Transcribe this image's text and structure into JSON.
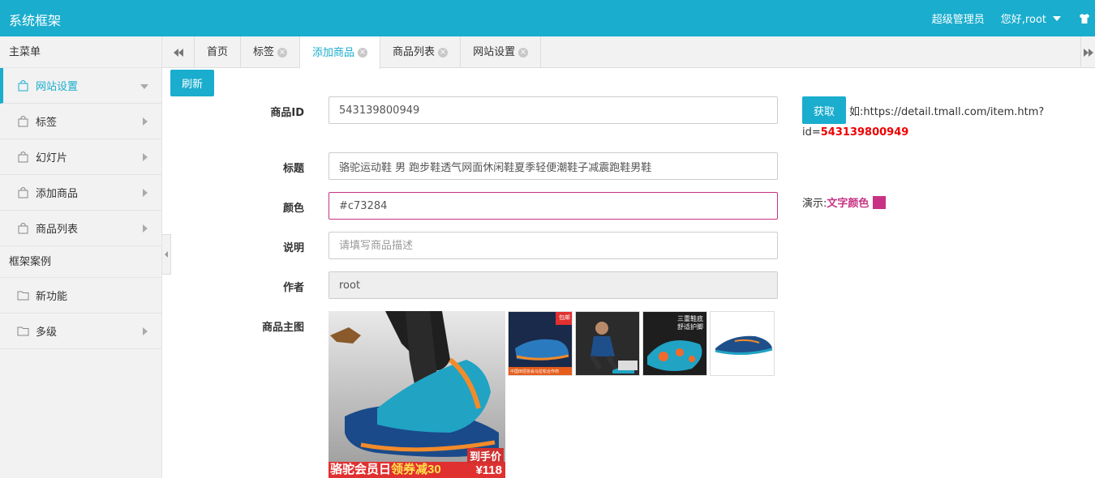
{
  "header": {
    "title": "系统框架",
    "role": "超级管理员",
    "greeting": "您好,root",
    "bg_color": "#1aadce"
  },
  "sidebar": {
    "main_menu_label": "主菜单",
    "items": [
      {
        "label": "网站设置",
        "icon": "bag-icon",
        "active": true,
        "expanded": true
      },
      {
        "label": "标签",
        "icon": "bag-icon"
      },
      {
        "label": "幻灯片",
        "icon": "bag-icon"
      },
      {
        "label": "添加商品",
        "icon": "bag-icon"
      },
      {
        "label": "商品列表",
        "icon": "bag-icon"
      }
    ],
    "examples_label": "框架案例",
    "example_items": [
      {
        "label": "新功能",
        "icon": "folder-icon"
      },
      {
        "label": "多级",
        "icon": "folder-icon"
      }
    ]
  },
  "tabs": [
    {
      "label": "首页",
      "closable": false
    },
    {
      "label": "标签",
      "closable": true
    },
    {
      "label": "添加商品",
      "closable": true,
      "active": true
    },
    {
      "label": "商品列表",
      "closable": true
    },
    {
      "label": "网站设置",
      "closable": true
    }
  ],
  "toolbar": {
    "refresh_label": "刷新"
  },
  "form": {
    "product_id": {
      "label": "商品ID",
      "value": "543139800949"
    },
    "title": {
      "label": "标题",
      "value": "骆驼运动鞋 男 跑步鞋透气网面休闲鞋夏季轻便潮鞋子减震跑鞋男鞋"
    },
    "color": {
      "label": "颜色",
      "value": "#c73284"
    },
    "description": {
      "label": "说明",
      "placeholder": "请填写商品描述"
    },
    "author": {
      "label": "作者",
      "value": "root"
    },
    "main_image": {
      "label": "商品主图"
    }
  },
  "fetch": {
    "button_label": "获取",
    "hint_prefix": "如:https://detail.tmall.com/item.htm?",
    "hint_id_prefix": "id=",
    "hint_id_value": "543139800949"
  },
  "demo": {
    "prefix": "演示:",
    "text": "文字颜色",
    "color": "#c73284"
  },
  "images": {
    "main_overlay_left": "骆驼会员日",
    "main_overlay_coupon": "领券减30",
    "main_price_label": "到手价",
    "main_price": "¥118",
    "thumb1_badge": "包邮",
    "thumb1_footer": "中国田径协会马拉松合作商",
    "thumb4_caption1": "三重鞋底",
    "thumb4_caption2": "舒适护脚"
  }
}
